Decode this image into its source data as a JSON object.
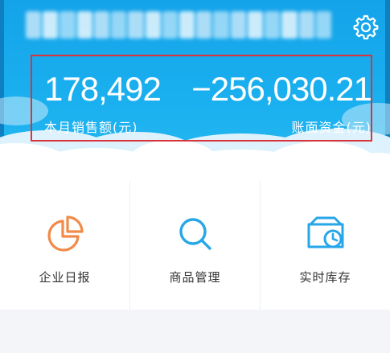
{
  "header": {
    "title_blurred": "",
    "settings_icon": "gear-icon"
  },
  "stats": {
    "monthly_sales": {
      "value": "178,492",
      "label": "本月销售额(元)"
    },
    "account_funds": {
      "value": "−256,030.21",
      "label": "账面资金(元)"
    }
  },
  "menu": {
    "items": [
      {
        "label": "企业日报",
        "icon": "pie-chart-icon",
        "color": "#f28a4a"
      },
      {
        "label": "商品管理",
        "icon": "search-icon",
        "color": "#27a6e8"
      },
      {
        "label": "实时库存",
        "icon": "inventory-clock-icon",
        "color": "#27a6e8"
      }
    ]
  },
  "colors": {
    "header_blue": "#1ab0ef",
    "highlight_border": "#d9343b"
  }
}
